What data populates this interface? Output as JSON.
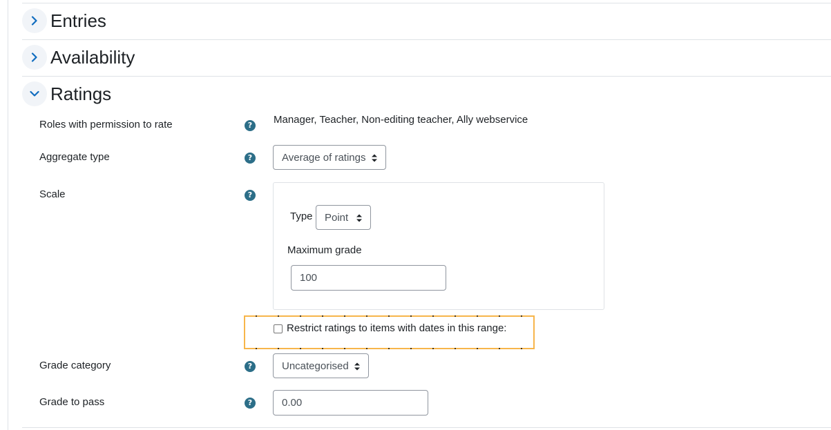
{
  "sections": {
    "entries": {
      "title": "Entries",
      "expanded": false
    },
    "availability": {
      "title": "Availability",
      "expanded": false
    },
    "ratings": {
      "title": "Ratings",
      "expanded": true
    }
  },
  "ratings": {
    "roles": {
      "label": "Roles with permission to rate",
      "value": "Manager, Teacher, Non-editing teacher, Ally webservice"
    },
    "aggregate": {
      "label": "Aggregate type",
      "value": "Average of ratings"
    },
    "scale": {
      "label": "Scale",
      "type_label": "Type",
      "type_value": "Point",
      "max_grade_label": "Maximum grade",
      "max_grade_value": "100"
    },
    "restrict": {
      "label": "Restrict ratings to items with dates in this range:",
      "checked": false
    },
    "grade_category": {
      "label": "Grade category",
      "value": "Uncategorised"
    },
    "grade_to_pass": {
      "label": "Grade to pass",
      "value": "0.00"
    }
  },
  "help_icon_glyph": "?",
  "colors": {
    "help_icon": "#2c6e88",
    "chevron": "#0f6cbf",
    "highlight_border": "#f7b54a"
  },
  "icons": {
    "collapsed": "chevron-right-icon",
    "expanded": "chevron-down-icon",
    "select": "sort-updown-icon",
    "help": "question-circle-icon"
  }
}
